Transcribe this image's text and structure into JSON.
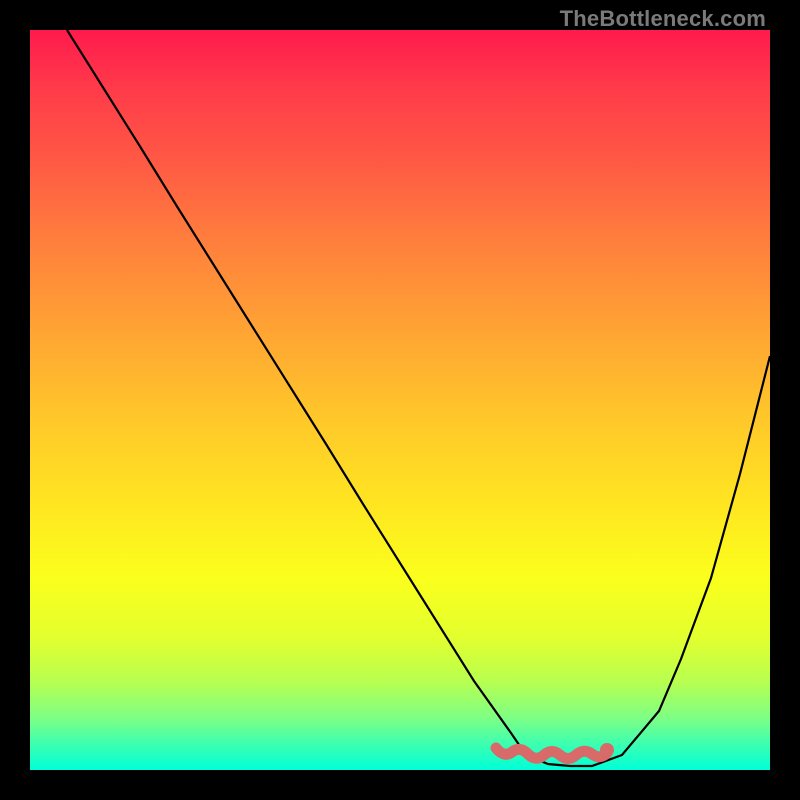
{
  "watermark": "TheBottleneck.com",
  "chart_data": {
    "type": "line",
    "title": "",
    "xlabel": "",
    "ylabel": "",
    "xlim": [
      0,
      100
    ],
    "ylim": [
      0,
      100
    ],
    "grid": false,
    "series": [
      {
        "name": "curve",
        "color": "#000000",
        "x": [
          5,
          10,
          15,
          20,
          25,
          30,
          35,
          40,
          45,
          50,
          55,
          60,
          65,
          67,
          70,
          73,
          76,
          80,
          85,
          88,
          92,
          96,
          100
        ],
        "y": [
          100,
          92,
          84,
          76,
          68,
          60,
          52,
          44,
          36,
          28,
          20,
          12,
          5,
          2,
          0.8,
          0.5,
          0.6,
          2,
          8,
          15,
          26,
          40,
          56
        ]
      }
    ],
    "annotations": [
      {
        "type": "band",
        "name": "optimal-range",
        "color": "#d86a6a",
        "x_start": 63,
        "x_end": 78,
        "y": 0.8
      }
    ]
  }
}
